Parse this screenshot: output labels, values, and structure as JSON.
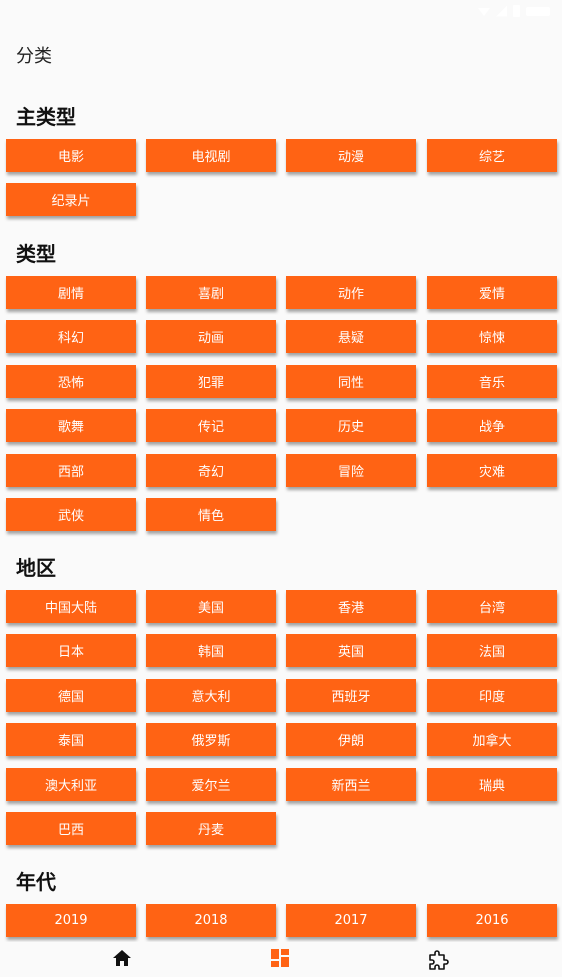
{
  "page": {
    "title": "分类"
  },
  "sections": [
    {
      "title": "主类型",
      "items": [
        "电影",
        "电视剧",
        "动漫",
        "综艺",
        "纪录片"
      ]
    },
    {
      "title": "类型",
      "items": [
        "剧情",
        "喜剧",
        "动作",
        "爱情",
        "科幻",
        "动画",
        "悬疑",
        "惊悚",
        "恐怖",
        "犯罪",
        "同性",
        "音乐",
        "歌舞",
        "传记",
        "历史",
        "战争",
        "西部",
        "奇幻",
        "冒险",
        "灾难",
        "武侠",
        "情色"
      ]
    },
    {
      "title": "地区",
      "items": [
        "中国大陆",
        "美国",
        "香港",
        "台湾",
        "日本",
        "韩国",
        "英国",
        "法国",
        "德国",
        "意大利",
        "西班牙",
        "印度",
        "泰国",
        "俄罗斯",
        "伊朗",
        "加拿大",
        "澳大利亚",
        "爱尔兰",
        "新西兰",
        "瑞典",
        "巴西",
        "丹麦"
      ]
    },
    {
      "title": "年代",
      "items": [
        "2019",
        "2018",
        "2017",
        "2016"
      ]
    }
  ],
  "bottom_nav": [
    {
      "icon": "home-icon"
    },
    {
      "icon": "category-grid-icon",
      "active": true
    },
    {
      "icon": "puzzle-icon"
    }
  ],
  "colors": {
    "accent": "#ff6314",
    "nav_active": "#ff6314",
    "background": "#fafafa"
  }
}
